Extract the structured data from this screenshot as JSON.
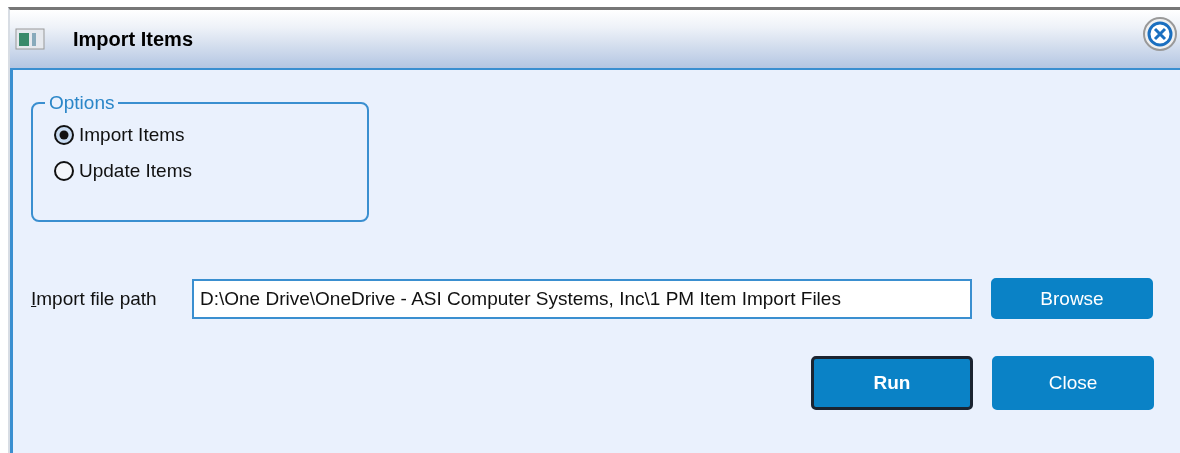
{
  "window": {
    "title": "Import Items"
  },
  "options": {
    "title": "Options",
    "choices": [
      {
        "label": "Import Items",
        "selected": true
      },
      {
        "label": "Update Items",
        "selected": false
      }
    ]
  },
  "file_path": {
    "label": "Import file path",
    "value": "D:\\One Drive\\OneDrive - ASI Computer Systems, Inc\\1 PM Item Import Files",
    "button": "Browse"
  },
  "buttons": [
    {
      "label": "Run",
      "default": true
    },
    {
      "label": "Close",
      "default": false
    }
  ]
}
